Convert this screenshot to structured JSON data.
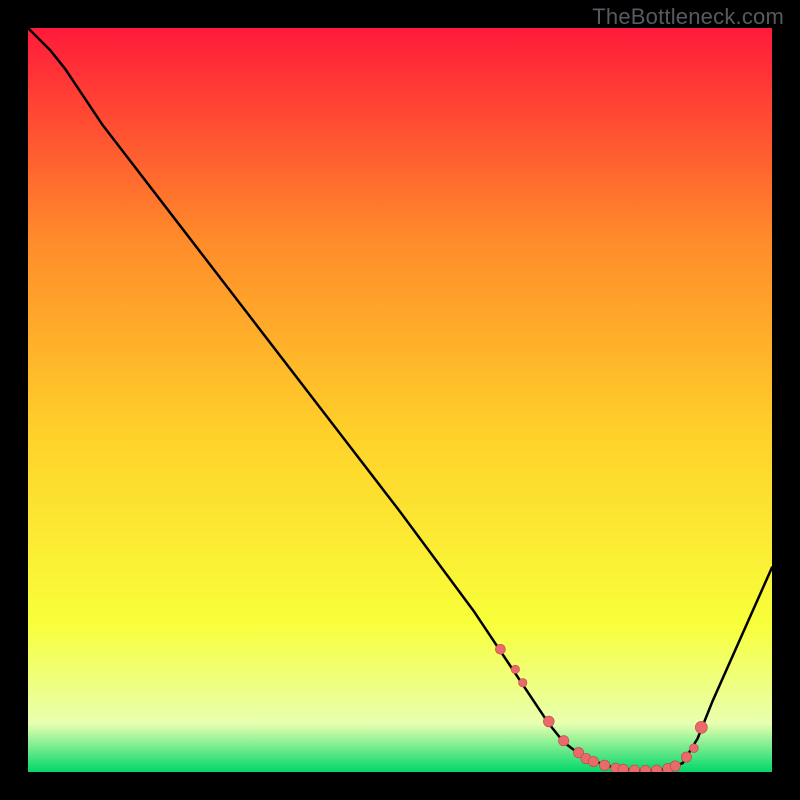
{
  "watermark": "TheBottleneck.com",
  "colors": {
    "page_bg": "#000000",
    "gradient_top": "#ff1a3a",
    "gradient_upper_mid": "#ff8a2a",
    "gradient_mid": "#ffd22a",
    "gradient_lower_mid": "#f8ff3a",
    "gradient_near_bottom": "#e8ffb0",
    "gradient_bottom": "#00d86a",
    "curve_stroke": "#000000",
    "marker_fill": "#e86a6a",
    "marker_stroke": "#c04646"
  },
  "chart_data": {
    "type": "line",
    "title": "",
    "xlabel": "",
    "ylabel": "",
    "xlim": [
      0,
      100
    ],
    "ylim": [
      0,
      100
    ],
    "grid": false,
    "legend_position": "none",
    "x": [
      0,
      3,
      5,
      10,
      20,
      30,
      40,
      50,
      60,
      63,
      67,
      70,
      72,
      74,
      76,
      78,
      80,
      82,
      84,
      86,
      88,
      90,
      92,
      100
    ],
    "values": [
      100,
      97,
      94.5,
      87,
      74,
      61,
      48,
      35,
      21.5,
      17,
      11,
      6.5,
      4,
      2.5,
      1.5,
      0.8,
      0.4,
      0.2,
      0.2,
      0.4,
      1.2,
      4.5,
      9.5,
      27.5
    ],
    "series": [
      {
        "name": "curve",
        "x": [
          0,
          3,
          5,
          10,
          20,
          30,
          40,
          50,
          60,
          63,
          67,
          70,
          72,
          74,
          76,
          78,
          80,
          82,
          84,
          86,
          88,
          90,
          92,
          100
        ],
        "values": [
          100,
          97,
          94.5,
          87,
          74,
          61,
          48,
          35,
          21.5,
          17,
          11,
          6.5,
          4,
          2.5,
          1.5,
          0.8,
          0.4,
          0.2,
          0.2,
          0.4,
          1.2,
          4.5,
          9.5,
          27.5
        ]
      }
    ],
    "markers": {
      "x": [
        63.5,
        65.5,
        66.5,
        70,
        72,
        74,
        75,
        76,
        77.5,
        79,
        80,
        81.5,
        83,
        84.5,
        86,
        87,
        88.5,
        89.5,
        90.5
      ],
      "y": [
        16.5,
        13.8,
        12,
        6.8,
        4.2,
        2.6,
        1.8,
        1.4,
        0.9,
        0.5,
        0.35,
        0.25,
        0.2,
        0.25,
        0.45,
        0.8,
        2,
        3.2,
        6
      ],
      "size": [
        5,
        4.2,
        4.2,
        5.4,
        5.2,
        5.2,
        5.2,
        5.2,
        5.2,
        5.2,
        5.2,
        5.2,
        5.2,
        5.2,
        5.2,
        5.2,
        5.2,
        4.4,
        6
      ]
    }
  }
}
